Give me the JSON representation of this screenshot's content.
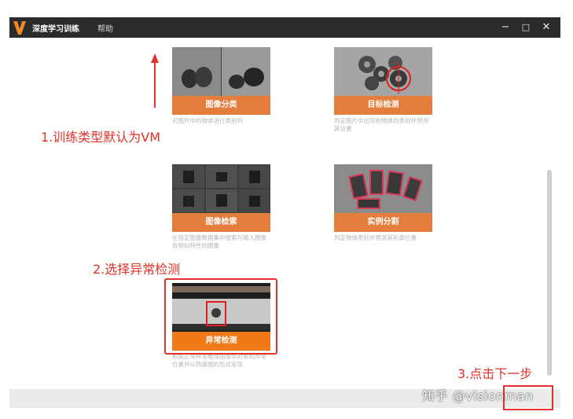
{
  "app": {
    "title": "深度学习训练",
    "menu_help": "帮助",
    "win_min": "−",
    "win_max": "□",
    "win_close": "✕"
  },
  "cards": [
    {
      "label": "图像分类",
      "desc": "对图片中的物体进行类别判"
    },
    {
      "label": "目标检测",
      "desc": "判定图片中出现的物体的类别并预测其位置"
    },
    {
      "label": "图像检索",
      "desc": "在指定图像数据集中搜索与输入图像有相似特性的图像"
    },
    {
      "label": "实例分割",
      "desc": "判定物体类别并预测其轮廓位置"
    },
    {
      "label": "异常检测",
      "desc": "根据正常样本推理图像中对象的异常位置并以热度图的形式呈现"
    }
  ],
  "annotations": {
    "step1": "1.训练类型默认为VM",
    "step2": "2.选择异常检测",
    "step3": "3.点击下一步"
  },
  "watermark": "知乎 @visionman",
  "colors": {
    "accent_orange": "#e57d3c",
    "annotation_red": "#e0312a",
    "titlebar": "#2b2b2b"
  }
}
